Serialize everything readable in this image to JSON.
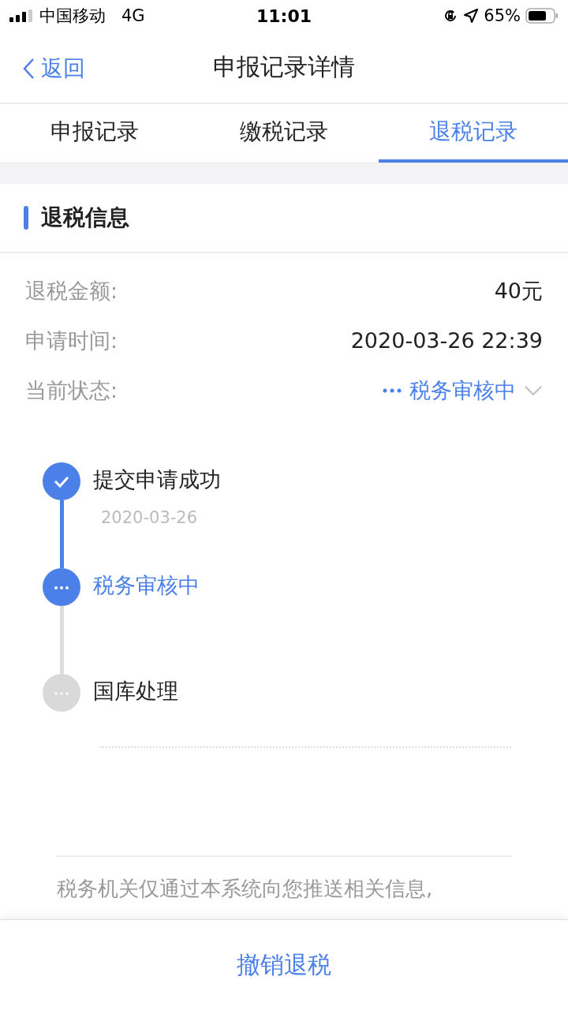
{
  "status_bar": {
    "carrier": "中国移动",
    "network": "4G",
    "time": "11:01",
    "battery": "65%"
  },
  "nav": {
    "back": "返回",
    "title": "申报记录详情"
  },
  "tabs": [
    {
      "label": "申报记录",
      "selected": false
    },
    {
      "label": "缴税记录",
      "selected": false
    },
    {
      "label": "退税记录",
      "selected": true
    }
  ],
  "section": {
    "title": "退税信息"
  },
  "fields": [
    {
      "label": "退税金额:",
      "value": "40元",
      "kind": "text"
    },
    {
      "label": "申请时间:",
      "value": "2020-03-26 22:39",
      "kind": "text"
    },
    {
      "label": "当前状态:",
      "value": "税务审核中",
      "kind": "status"
    }
  ],
  "timeline": [
    {
      "title": "提交申请成功",
      "date": "2020-03-26",
      "completed": true,
      "active": false
    },
    {
      "title": "税务审核中",
      "completed": false,
      "active": true
    },
    {
      "title": "国库处理",
      "completed": false,
      "active": false
    }
  ],
  "notice": "税务机关仅通过本系统向您推送相关信息,",
  "footer": {
    "button": "撤销退税"
  }
}
